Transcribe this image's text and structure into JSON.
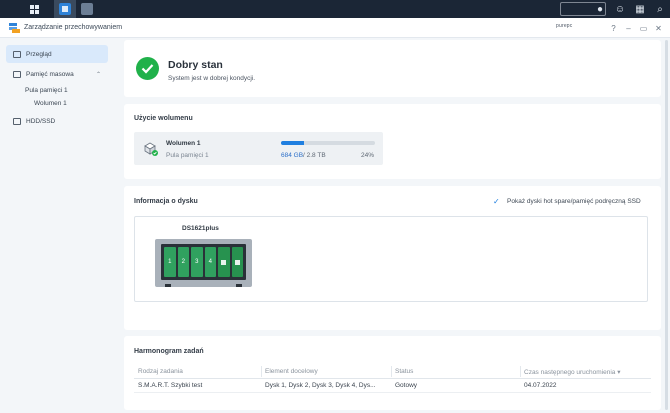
{
  "taskbar": {
    "apps": [
      "main-menu",
      "storage-manager",
      "second-app"
    ]
  },
  "window": {
    "title": "Zarządzanie przechowywaniem",
    "watermark": "purepc",
    "controls": [
      "?",
      "–",
      "▭",
      "✕"
    ]
  },
  "sidebar": {
    "overview": "Przegląd",
    "storage": "Pamięć masowa",
    "pool": "Pula pamięci 1",
    "volume": "Wolumen 1",
    "hdd": "HDD/SSD"
  },
  "status": {
    "title": "Dobry stan",
    "subtitle": "System jest w dobrej kondycji."
  },
  "volume_usage": {
    "heading": "Użycie wolumenu",
    "name": "Wolumen 1",
    "pool": "Pula pamięci 1",
    "used": "684 GB",
    "separator": "/",
    "total": "2.8 TB",
    "percent": "24%",
    "fill_fraction": 0.24
  },
  "disk_info": {
    "heading": "Informacja o dysku",
    "checkbox_label": "Pokaż dyski hot spare/pamięć podręczną SSD",
    "model": "DS1621plus",
    "bays": [
      "1",
      "2",
      "3",
      "4",
      "",
      ""
    ]
  },
  "schedule": {
    "heading": "Harmonogram zadań",
    "columns": [
      "Rodzaj zadania",
      "Element docelowy",
      "Status",
      "Czas następnego uruchomienia ▾"
    ],
    "rows": [
      [
        "S.M.A.R.T. Szybki test",
        "Dysk 1, Dysk 2, Dysk 3, Dysk 4, Dys...",
        "Gotowy",
        "04.07.2022"
      ]
    ]
  },
  "colors": {
    "accent": "#1f7fe0",
    "ok": "#20b14a",
    "taskbar": "#1b2636"
  }
}
